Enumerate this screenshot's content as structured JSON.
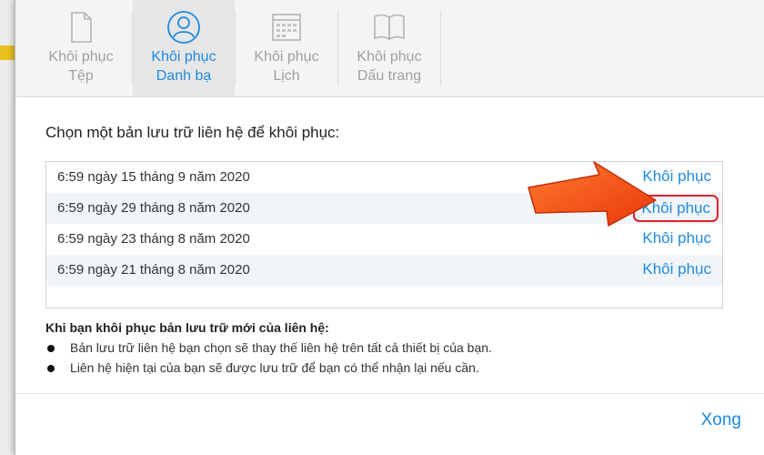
{
  "tabs": [
    {
      "line1": "Khôi phục",
      "line2": "Tệp",
      "icon": "document-icon",
      "active": false
    },
    {
      "line1": "Khôi phục",
      "line2": "Danh bạ",
      "icon": "contact-icon",
      "active": true
    },
    {
      "line1": "Khôi phục",
      "line2": "Lịch",
      "icon": "calendar-icon",
      "active": false
    },
    {
      "line1": "Khôi phục",
      "line2": "Dấu trang",
      "icon": "bookmark-icon",
      "active": false
    }
  ],
  "prompt": "Chọn một bản lưu trữ liên hệ để khôi phục:",
  "archives": [
    {
      "date": "6:59 ngày 15 tháng 9 năm 2020",
      "action": "Khôi phục"
    },
    {
      "date": "6:59 ngày 29 tháng 8 năm 2020",
      "action": "Khôi phục"
    },
    {
      "date": "6:59 ngày 23 tháng 8 năm 2020",
      "action": "Khôi phục"
    },
    {
      "date": "6:59 ngày 21 tháng 8 năm 2020",
      "action": "Khôi phục"
    }
  ],
  "note": {
    "title": "Khi bạn khôi phục bản lưu trữ mới của liên hệ:",
    "bullets": [
      "Bản lưu trữ liên hệ bạn chọn sẽ thay thế liên hệ trên tất cả thiết bị của bạn.",
      "Liên hệ hiện tại của bạn sẽ được lưu trữ để bạn có thể nhận lại nếu cần."
    ]
  },
  "done_label": "Xong",
  "colors": {
    "accent": "#1e8ae0",
    "highlight": "#e0202a",
    "arrow": "#f04a10"
  }
}
